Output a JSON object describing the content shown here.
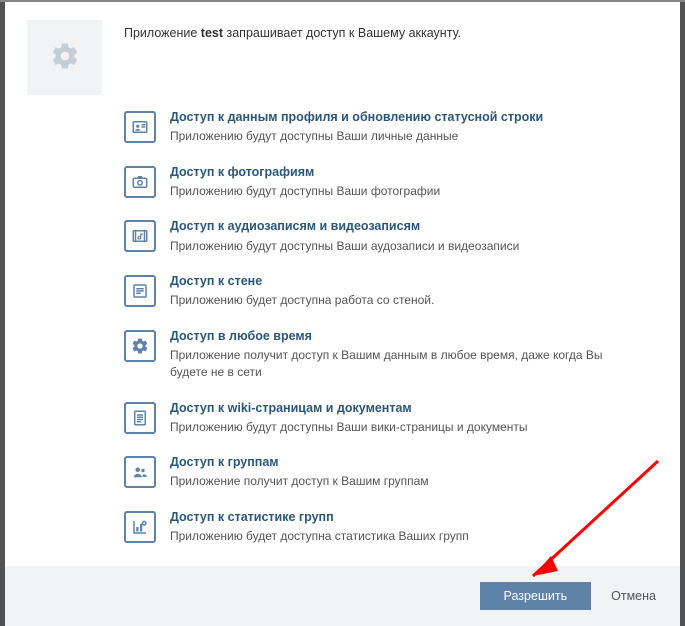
{
  "intro": {
    "prefix": "Приложение ",
    "app_name": "test",
    "suffix": " запрашивает доступ к Вашему аккаунту."
  },
  "permissions": [
    {
      "icon": "profile-card-icon",
      "title": "Доступ к данным профиля и обновлению статусной строки",
      "desc": "Приложению будут доступны Ваши личные данные"
    },
    {
      "icon": "camera-icon",
      "title": "Доступ к фотографиям",
      "desc": "Приложению будут доступны Ваши фотографии"
    },
    {
      "icon": "audio-video-icon",
      "title": "Доступ к аудиозаписям и видеозаписям",
      "desc": "Приложению будут доступны Ваши аудозаписи и видеозаписи"
    },
    {
      "icon": "wall-icon",
      "title": "Доступ к стене",
      "desc": "Приложению будет доступна работа со стеной."
    },
    {
      "icon": "anytime-gear-icon",
      "title": "Доступ в любое время",
      "desc": "Приложение получит доступ к Вашим данным в любое время, даже когда Вы будете не в сети"
    },
    {
      "icon": "document-icon",
      "title": "Доступ к wiki-страницам и документам",
      "desc": "Приложению будут доступны Ваши вики-страницы и документы"
    },
    {
      "icon": "groups-icon",
      "title": "Доступ к группам",
      "desc": "Приложение получит доступ к Вашим группам"
    },
    {
      "icon": "stats-icon",
      "title": "Доступ к статистике групп",
      "desc": "Приложению будет доступна статистика Ваших групп"
    }
  ],
  "footer": {
    "allow_label": "Разрешить",
    "cancel_label": "Отмена"
  }
}
